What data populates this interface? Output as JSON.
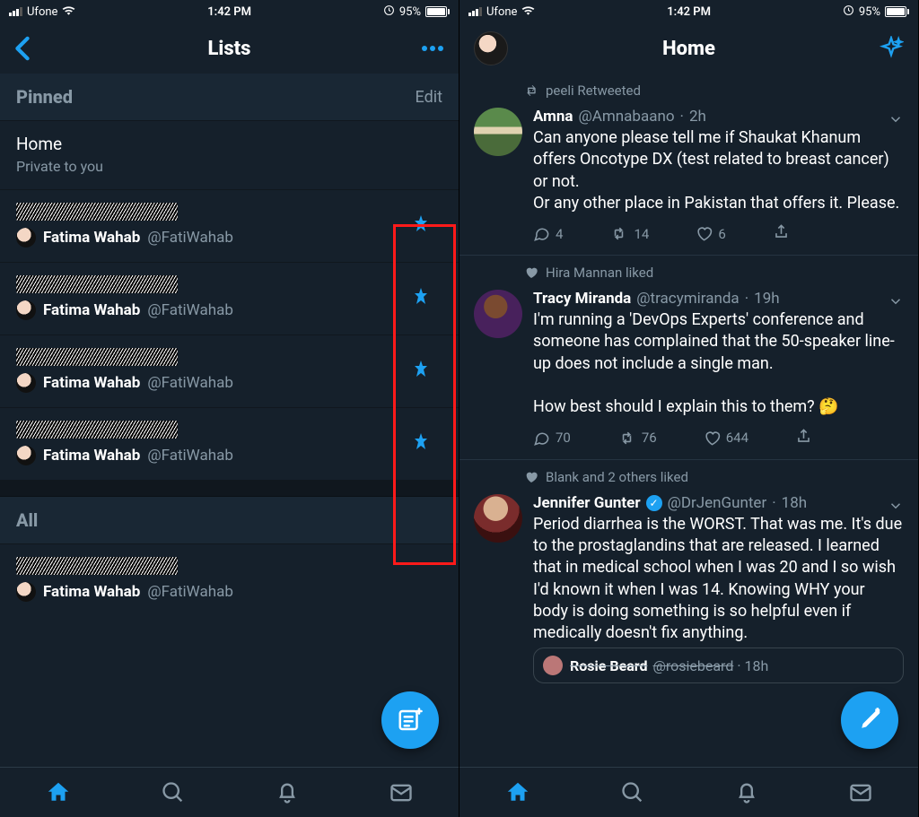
{
  "status": {
    "carrier": "Ufone",
    "time": "1:42 PM",
    "battery": "95%"
  },
  "left": {
    "title": "Lists",
    "pinned": {
      "label": "Pinned",
      "edit": "Edit"
    },
    "homeList": {
      "title": "Home",
      "subtitle": "Private to you"
    },
    "owner": {
      "name": "Fatima Wahab",
      "handle": "@FatiWahab"
    },
    "all": {
      "label": "All"
    }
  },
  "right": {
    "title": "Home",
    "tweets": [
      {
        "context": "peeli Retweeted",
        "contextType": "retweet",
        "name": "Amna",
        "handle": "@Amnabaano",
        "time": "2h",
        "text": "Can anyone please tell me if Shaukat Khanum offers Oncotype DX (test related to breast cancer) or not.\nOr any other place in Pakistan that offers it. Please.",
        "reply": "4",
        "retweet": "14",
        "like": "6",
        "avatar": "landscape"
      },
      {
        "context": "Hira Mannan liked",
        "contextType": "like",
        "name": "Tracy Miranda",
        "handle": "@tracymiranda",
        "time": "19h",
        "text": "I'm running a 'DevOps Experts' conference and someone has complained that the 50-speaker line-up does not include a single man.\n\nHow best should I explain this to them? 🤔",
        "reply": "70",
        "retweet": "76",
        "like": "644",
        "avatar": "portrait1"
      },
      {
        "context": "Blank and 2 others liked",
        "contextType": "like",
        "name": "Jennifer Gunter",
        "handle": "@DrJenGunter",
        "verified": true,
        "time": "18h",
        "text": "Period diarrhea is the WORST. That was me. It's due to the prostaglandins that are released. I learned that in medical school when I was 20 and I so wish I'd known it when I was 14. Knowing WHY your body is doing something is so helpful even if medically doesn't fix anything.",
        "avatar": "portrait2"
      }
    ],
    "quotedPreview": {
      "name": "Rosie Beard",
      "handle": "@rosiebeard",
      "time": "18h"
    }
  }
}
